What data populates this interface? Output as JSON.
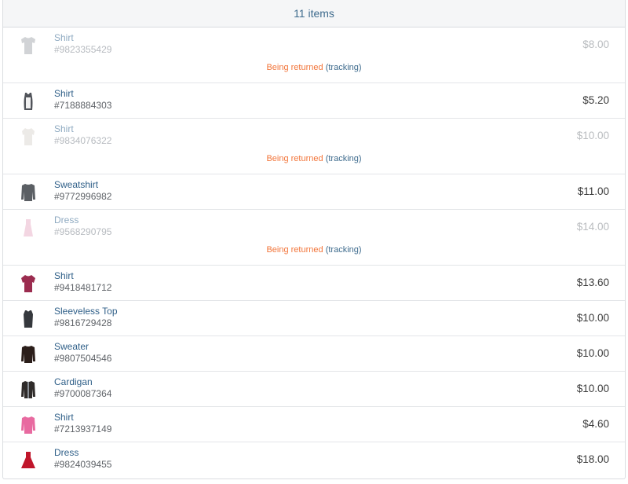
{
  "header": {
    "title": "11 items"
  },
  "items": [
    {
      "name": "Shirt",
      "sku": "#9823355429",
      "price": "$8.00",
      "icon": "tshirt-icon",
      "color": "#9aa0a6",
      "faded": true,
      "status": "Being returned",
      "link": "(tracking)"
    },
    {
      "name": "Shirt",
      "sku": "#7188884303",
      "price": "$5.20",
      "icon": "tank-top-icon",
      "color": "#51545a",
      "faded": false
    },
    {
      "name": "Shirt",
      "sku": "#9834076322",
      "price": "$10.00",
      "icon": "blouse-icon",
      "color": "#d7d2cc",
      "faded": true,
      "status": "Being returned",
      "link": "(tracking)"
    },
    {
      "name": "Sweatshirt",
      "sku": "#9772996982",
      "price": "$11.00",
      "icon": "sweatshirt-icon",
      "color": "#5b5f64",
      "faded": false
    },
    {
      "name": "Dress",
      "sku": "#9568290795",
      "price": "$14.00",
      "icon": "dress-icon",
      "color": "#e6a6bf",
      "faded": true,
      "status": "Being returned",
      "link": "(tracking)"
    },
    {
      "name": "Shirt",
      "sku": "#9418481712",
      "price": "$13.60",
      "icon": "shirt-icon",
      "color": "#9b2c4f",
      "faded": false
    },
    {
      "name": "Sleeveless Top",
      "sku": "#9816729428",
      "price": "$10.00",
      "icon": "sleeveless-top-icon",
      "color": "#35383d",
      "faded": false
    },
    {
      "name": "Sweater",
      "sku": "#9807504546",
      "price": "$10.00",
      "icon": "sweater-icon",
      "color": "#2b1e1a",
      "faded": false
    },
    {
      "name": "Cardigan",
      "sku": "#9700087364",
      "price": "$10.00",
      "icon": "cardigan-icon",
      "color": "#2f2b2a",
      "faded": false
    },
    {
      "name": "Shirt",
      "sku": "#7213937149",
      "price": "$4.60",
      "icon": "shirt-icon",
      "color": "#e86aa0",
      "faded": false
    },
    {
      "name": "Dress",
      "sku": "#9824039455",
      "price": "$18.00",
      "icon": "dress-icon",
      "color": "#c0162b",
      "faded": false
    }
  ]
}
